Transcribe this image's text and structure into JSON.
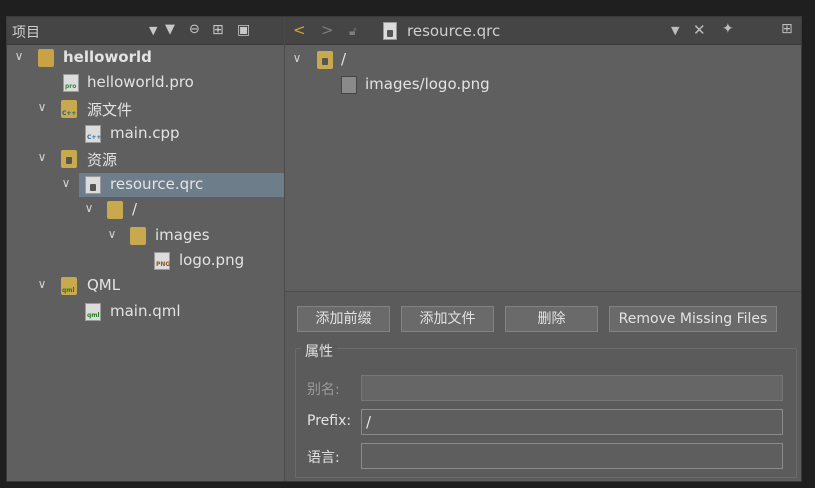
{
  "left_toolbar": {
    "title": "项目",
    "dropdown_icon": "chevron-down-icon",
    "filter_icon": "filter-icon",
    "link_icon": "link-icon",
    "split_icon": "split-icon",
    "close_pane_icon": "close-pane-icon"
  },
  "tree": {
    "items": [
      {
        "label": "helloworld",
        "expanded": true
      },
      {
        "label": "helloworld.pro"
      },
      {
        "label": "源文件",
        "expanded": true
      },
      {
        "label": "main.cpp"
      },
      {
        "label": "资源",
        "expanded": true
      },
      {
        "label": "resource.qrc",
        "expanded": true,
        "selected": true
      },
      {
        "label": "/",
        "expanded": true
      },
      {
        "label": "images",
        "expanded": true
      },
      {
        "label": "logo.png"
      },
      {
        "label": "QML",
        "expanded": true
      },
      {
        "label": "main.qml"
      }
    ]
  },
  "right_toolbar": {
    "filename": "resource.qrc",
    "back_icon": "back-arrow-icon",
    "forward_icon": "forward-arrow-icon",
    "lock_icon": "lock-icon",
    "file_icon": "qrc-file-icon",
    "dropdown_icon": "chevron-down-icon",
    "close_icon": "close-icon",
    "pin_icon": "pin-icon",
    "split_icon": "split-icon"
  },
  "resource_tree": {
    "prefix": "/",
    "file": "images/logo.png"
  },
  "buttons": {
    "add_prefix": "添加前缀",
    "add_files": "添加文件",
    "delete": "删除",
    "remove_missing": "Remove Missing Files"
  },
  "properties": {
    "group_title": "属性",
    "alias_label": "别名:",
    "alias_value": "",
    "prefix_label": "Prefix:",
    "prefix_value": "/",
    "lang_label": "语言:",
    "lang_value": ""
  }
}
